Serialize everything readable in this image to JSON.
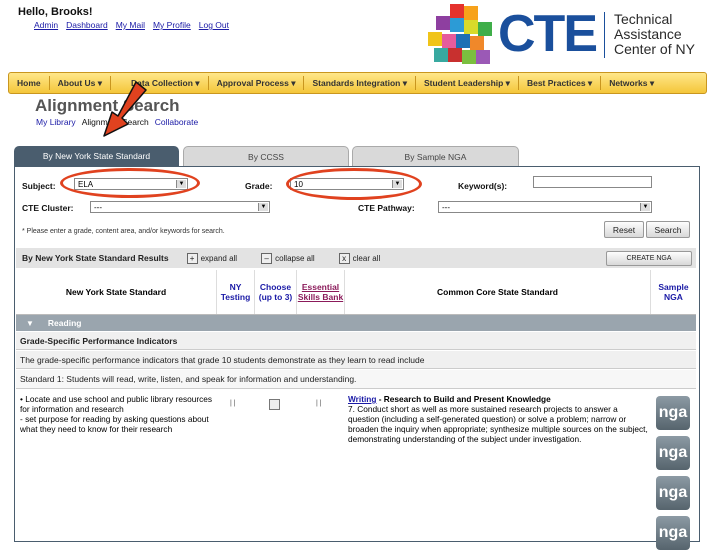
{
  "header": {
    "greeting": "Hello, Brooks!",
    "links": [
      "Admin",
      "Dashboard",
      "My Mail",
      "My Profile",
      "Log Out"
    ]
  },
  "logo": {
    "brand": "CTE",
    "tagline_lines": [
      "Technical",
      "Assistance",
      "Center of NY"
    ],
    "brand_color": "#1a4f9c"
  },
  "nav": {
    "items": [
      "Home",
      "About Us",
      "Data Collection",
      "Approval Process",
      "Standards Integration",
      "Student Leadership",
      "Best Practices",
      "Networks"
    ]
  },
  "page": {
    "title": "Alignment Search",
    "subnav": [
      "My Library",
      "Alignment Search",
      "Collaborate"
    ]
  },
  "tabs": [
    "By New York State Standard",
    "By CCSS",
    "By Sample NGA"
  ],
  "search": {
    "subject_label": "Subject:",
    "subject_value": "ELA",
    "grade_label": "Grade:",
    "grade_value": "10",
    "keywords_label": "Keyword(s):",
    "keywords_value": "",
    "cluster_label": "CTE Cluster:",
    "cluster_value": "---",
    "pathway_label": "CTE Pathway:",
    "pathway_value": "---",
    "note": "* Please enter a grade, content area, and/or keywords for search.",
    "reset_label": "Reset",
    "search_label": "Search"
  },
  "results": {
    "title": "By New York State Standard Results",
    "expand_all": "expand all",
    "collapse_all": "collapse all",
    "clear_all": "clear all",
    "create_nga": "CREATE NGA",
    "columns": {
      "nys": "New York State Standard",
      "ny_testing": "NY Testing",
      "choose": "Choose (up to 3)",
      "ess": "Essential Skills Bank",
      "ccss": "Common Core State Standard",
      "sample_nga": "Sample NGA"
    },
    "section": "Reading",
    "row1": "Grade-Specific Performance Indicators",
    "row2": "The grade-specific performance indicators that grade 10 students demonstrate as they learn to read include",
    "row3": "Standard 1: Students will read, write, listen, and speak for information and understanding.",
    "item_text": "• Locate and use school and public library resources for information and research\n- set purpose for reading by asking questions about what they need to know for their research",
    "ccss_link": "Writing",
    "ccss_title": " - Research to Build and Present Knowledge",
    "ccss_body": "7. Conduct short as well as more sustained research projects to answer a question (including a self-generated question) or solve a problem; narrow or broaden the inquiry when appropriate; synthesize multiple sources on the subject, demonstrating understanding of the subject under investigation.",
    "nga_label": "nga"
  },
  "colors": {
    "nav_bg": "#f4c63a",
    "tab_active": "#4a5d6e",
    "annotation_red": "#e0421f"
  }
}
